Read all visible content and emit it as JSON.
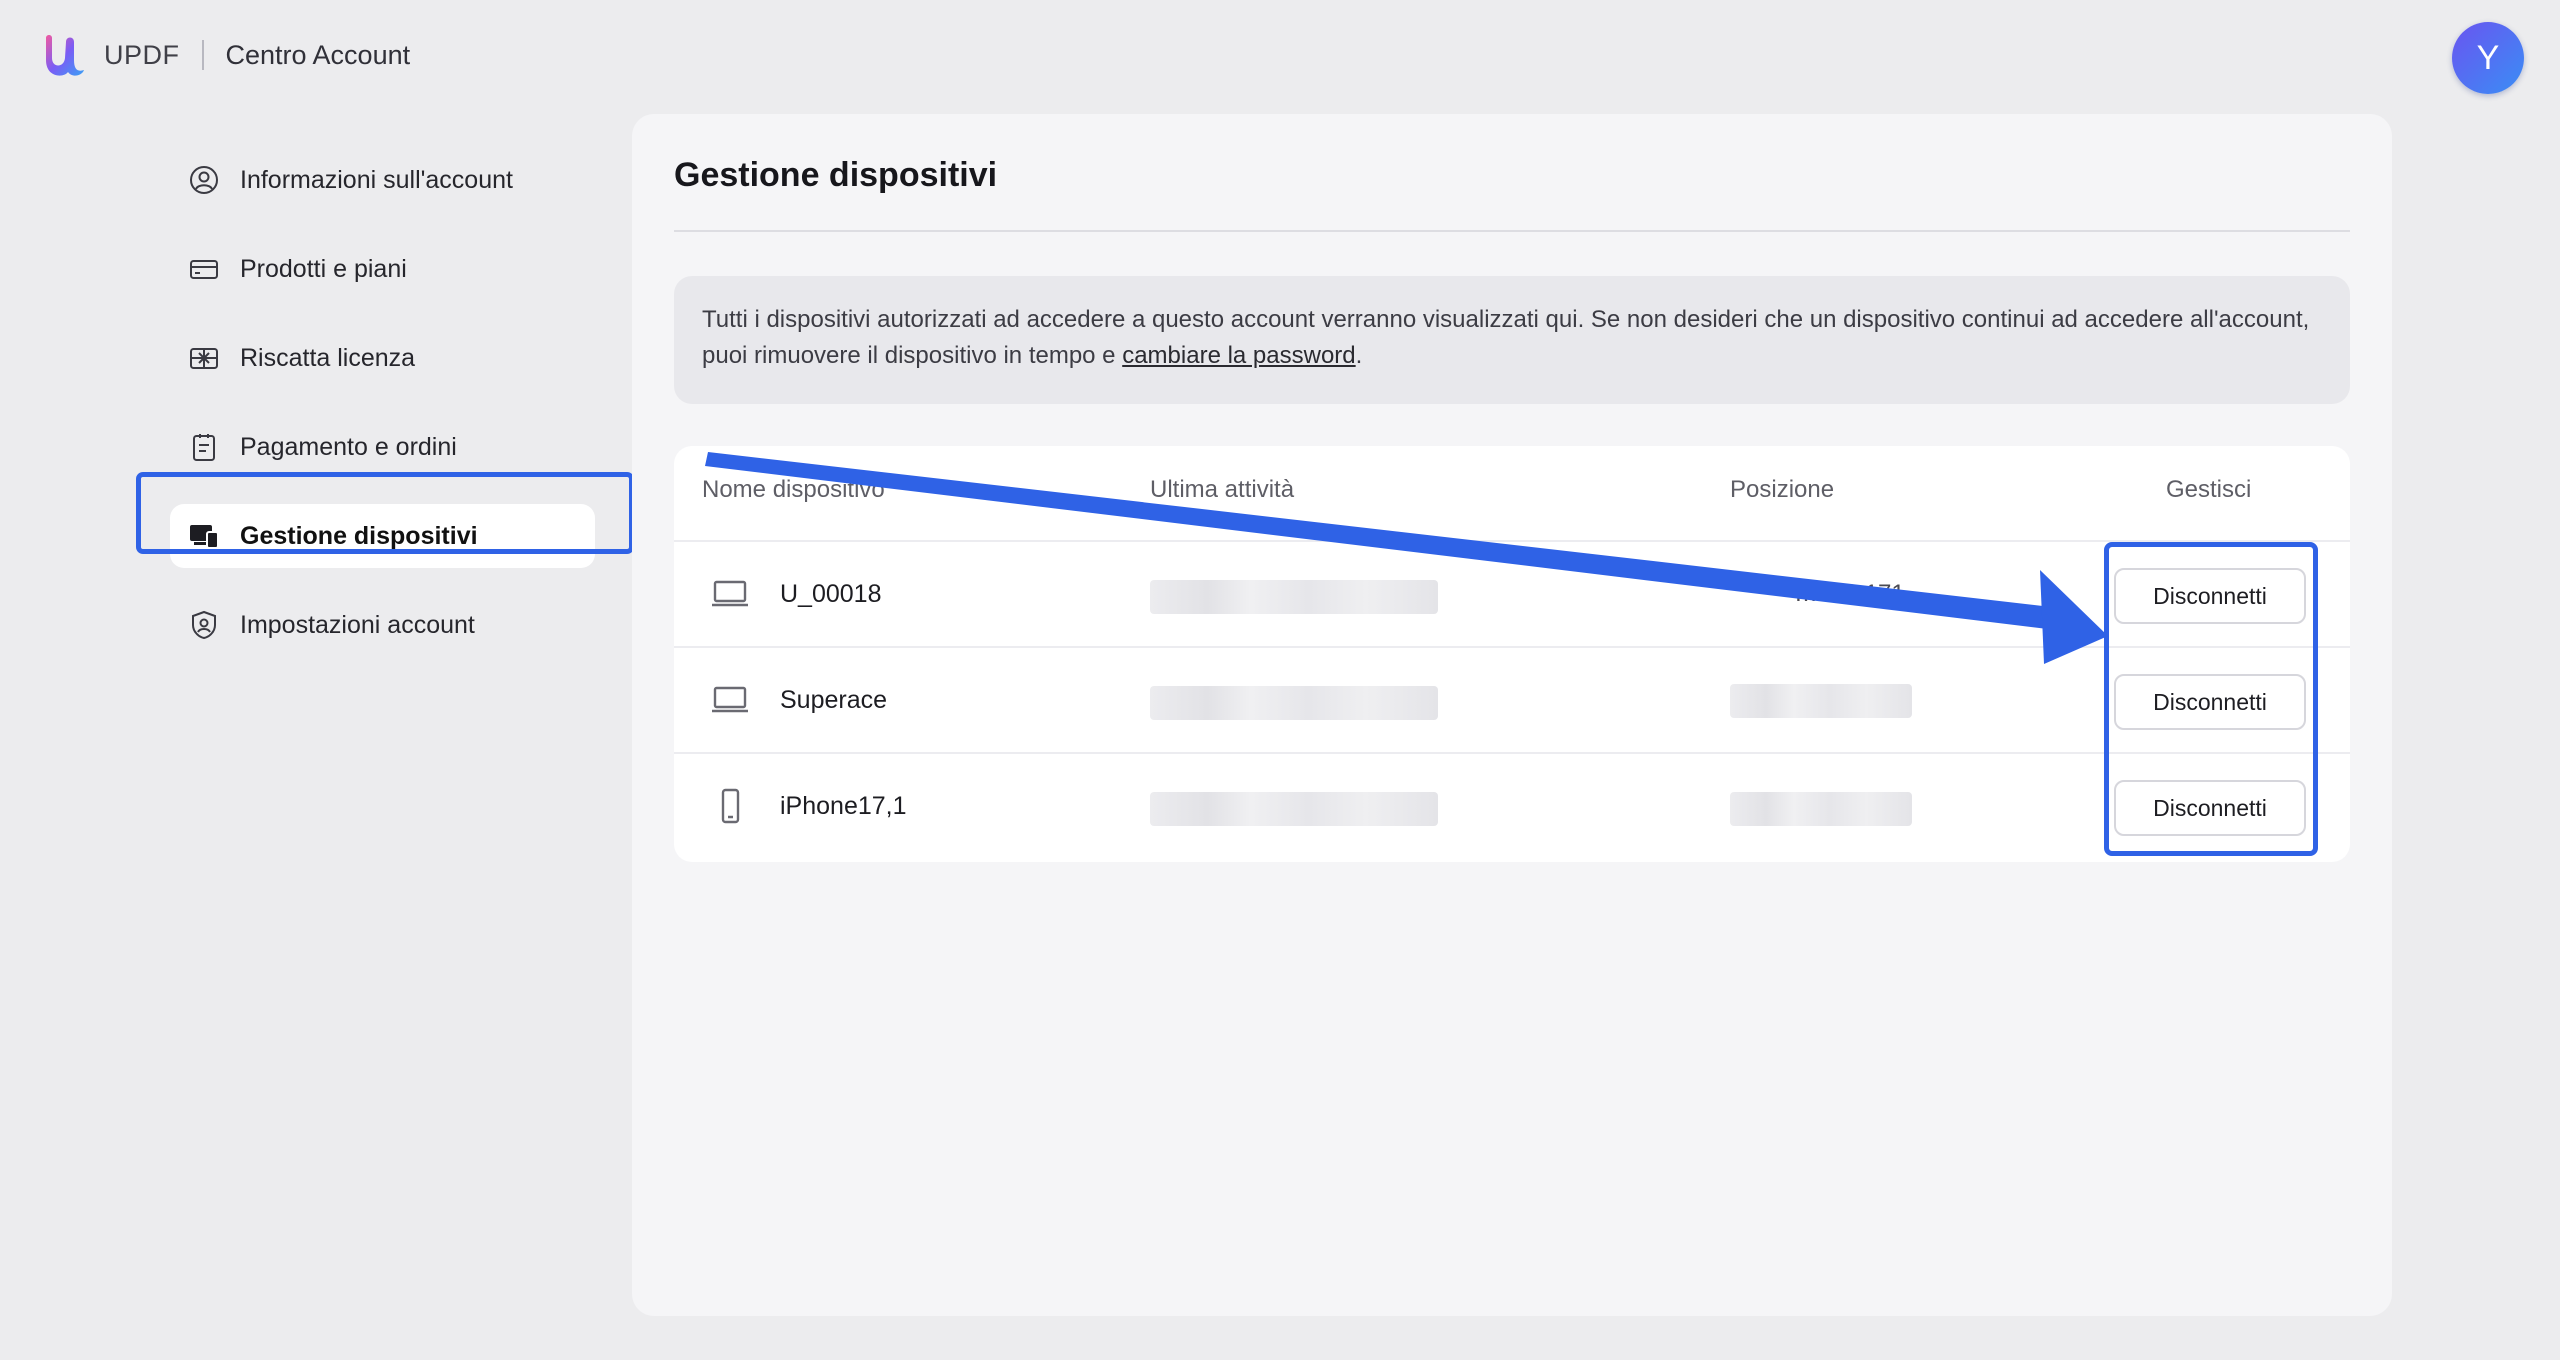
{
  "header": {
    "brand": "UPDF",
    "section_title": "Centro Account",
    "avatar_initial": "Y"
  },
  "sidebar": {
    "items": [
      {
        "label": "Informazioni sull'account",
        "icon": "user-circle-icon"
      },
      {
        "label": "Prodotti e piani",
        "icon": "card-icon"
      },
      {
        "label": "Riscatta licenza",
        "icon": "gift-icon"
      },
      {
        "label": "Pagamento e ordini",
        "icon": "clipboard-icon"
      },
      {
        "label": "Gestione dispositivi",
        "icon": "devices-icon",
        "active": true
      },
      {
        "label": "Impostazioni account",
        "icon": "shield-user-icon"
      }
    ]
  },
  "main": {
    "title": "Gestione dispositivi",
    "notice_text": "Tutti i dispositivi autorizzati ad accedere a questo account verranno visualizzati qui. Se non desideri che un dispositivo continui ad accedere all'account, puoi rimuovere il dispositivo in tempo e ",
    "notice_link": "cambiare la password",
    "notice_end": ".",
    "table": {
      "columns": [
        "Nome dispositivo",
        "Ultima attività",
        "Posizione",
        "Gestisci"
      ],
      "rows": [
        {
          "device": "U_00018",
          "type": "laptop",
          "location_partial": "…148.171",
          "action": "Disconnetti"
        },
        {
          "device": "Superace",
          "type": "laptop",
          "location_partial": "",
          "action": "Disconnetti"
        },
        {
          "device": "iPhone17,1",
          "type": "phone",
          "location_partial": "",
          "action": "Disconnetti"
        }
      ]
    }
  },
  "colors": {
    "accent_annotation": "#2f62e6",
    "avatar_gradient_start": "#6a54f0",
    "avatar_gradient_end": "#3a8ef5",
    "background": "#ececee"
  }
}
